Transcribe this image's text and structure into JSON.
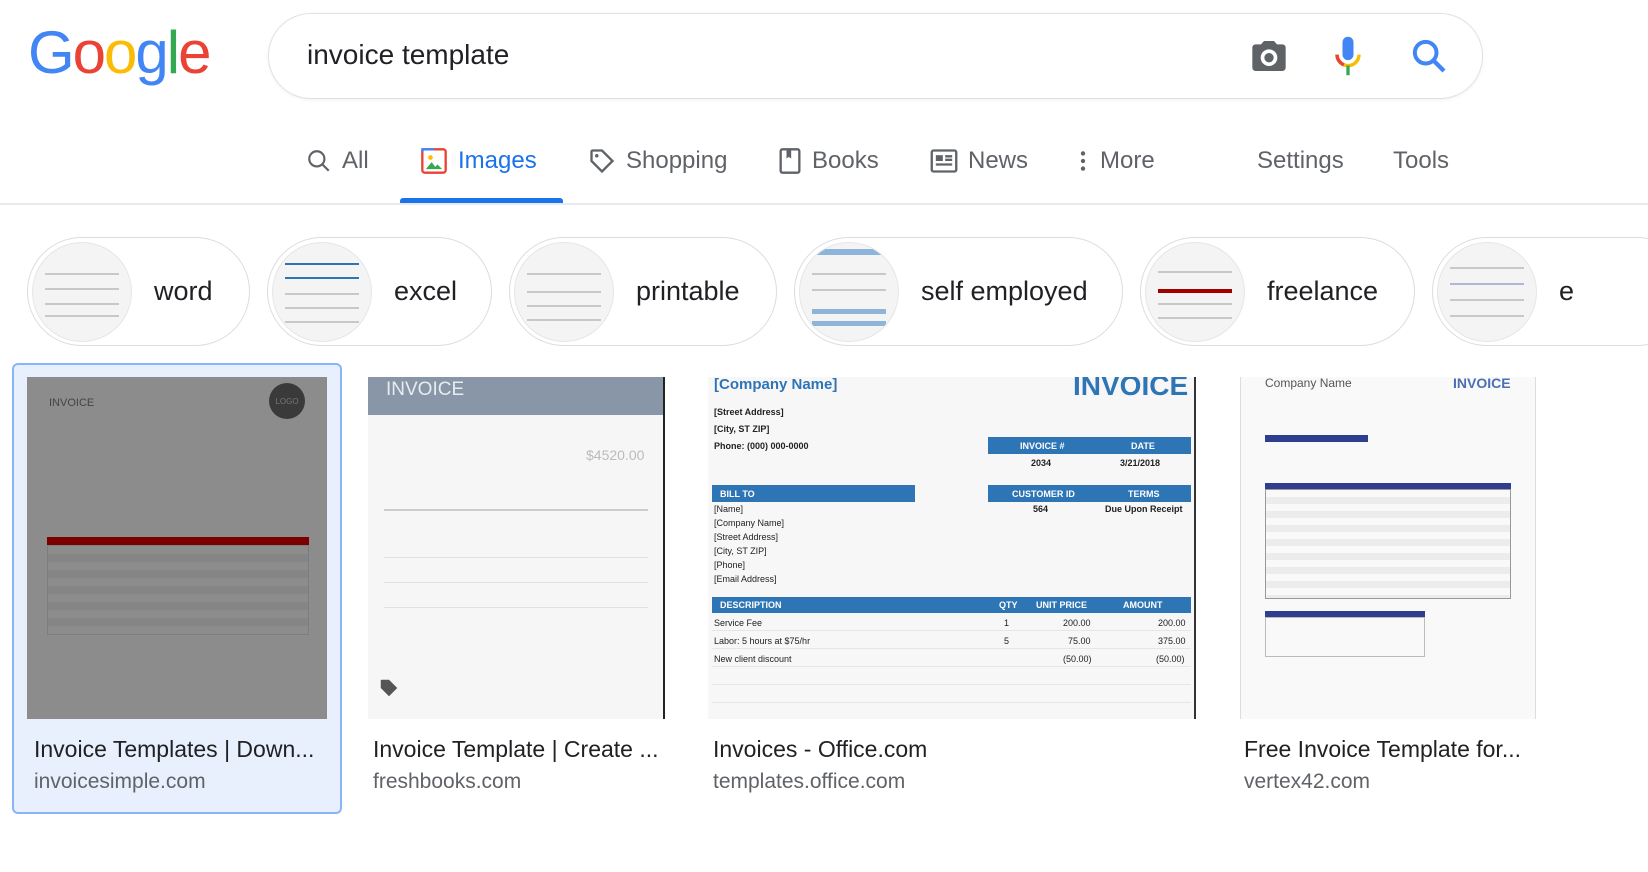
{
  "logo": {
    "letters": [
      "G",
      "o",
      "o",
      "g",
      "l",
      "e"
    ],
    "colors": [
      "#4285f4",
      "#ea4335",
      "#fbbc05",
      "#4285f4",
      "#34a853",
      "#ea4335"
    ]
  },
  "search": {
    "query": "invoice template",
    "icons": [
      "camera-icon",
      "microphone-icon",
      "search-icon"
    ]
  },
  "tabs": [
    {
      "label": "All",
      "icon": "search-icon",
      "active": false
    },
    {
      "label": "Images",
      "icon": "image-icon",
      "active": true
    },
    {
      "label": "Shopping",
      "icon": "tag-icon",
      "active": false
    },
    {
      "label": "Books",
      "icon": "book-icon",
      "active": false
    },
    {
      "label": "News",
      "icon": "newspaper-icon",
      "active": false
    },
    {
      "label": "More",
      "icon": "more-vertical-icon",
      "active": false
    }
  ],
  "tools": {
    "settings": "Settings",
    "tools": "Tools"
  },
  "chips": [
    {
      "label": "word"
    },
    {
      "label": "excel"
    },
    {
      "label": "printable"
    },
    {
      "label": "self employed"
    },
    {
      "label": "freelance"
    },
    {
      "label": "e"
    }
  ],
  "results": [
    {
      "title": "Invoice Templates | Down...",
      "domain": "invoicesimple.com",
      "selected": true
    },
    {
      "title": "Invoice Template | Create ...",
      "domain": "freshbooks.com",
      "selected": false
    },
    {
      "title": "Invoices - Office.com",
      "domain": "templates.office.com",
      "selected": false
    },
    {
      "title": "Free Invoice Template for...",
      "domain": "vertex42.com",
      "selected": false
    }
  ],
  "thumb_text": {
    "r1": {
      "heading": "INVOICE",
      "logo": "LOGO"
    },
    "r2": {
      "heading": "INVOICE",
      "total": "$4520.00"
    },
    "r3": {
      "company": "[Company Name]",
      "heading": "INVOICE",
      "street": "[Street Address]",
      "city": "[City, ST ZIP]",
      "phone": "Phone: (000) 000-0000",
      "inv_no_h": "INVOICE #",
      "date_h": "DATE",
      "inv_no": "2034",
      "date": "3/21/2018",
      "bill_to": "BILL TO",
      "cust_h": "CUSTOMER ID",
      "terms_h": "TERMS",
      "cust": "564",
      "terms": "Due Upon Receipt",
      "bill_lines": [
        "[Name]",
        "[Company Name]",
        "[Street Address]",
        "[City, ST ZIP]",
        "[Phone]",
        "[Email Address]"
      ],
      "cols": [
        "DESCRIPTION",
        "QTY",
        "UNIT PRICE",
        "AMOUNT"
      ],
      "rows": [
        [
          "Service Fee",
          "1",
          "200.00",
          "200.00"
        ],
        [
          "Labor: 5 hours at $75/hr",
          "5",
          "75.00",
          "375.00"
        ],
        [
          "New client discount",
          "",
          "(50.00)",
          "(50.00)"
        ]
      ]
    },
    "r4": {
      "company": "Company Name",
      "heading": "INVOICE"
    }
  },
  "colors": {
    "accent": "#1a73e8",
    "office_blue": "#2e75b6",
    "invoicesimple_red": "#a00000",
    "vertex_navy": "#2f3f8f"
  }
}
